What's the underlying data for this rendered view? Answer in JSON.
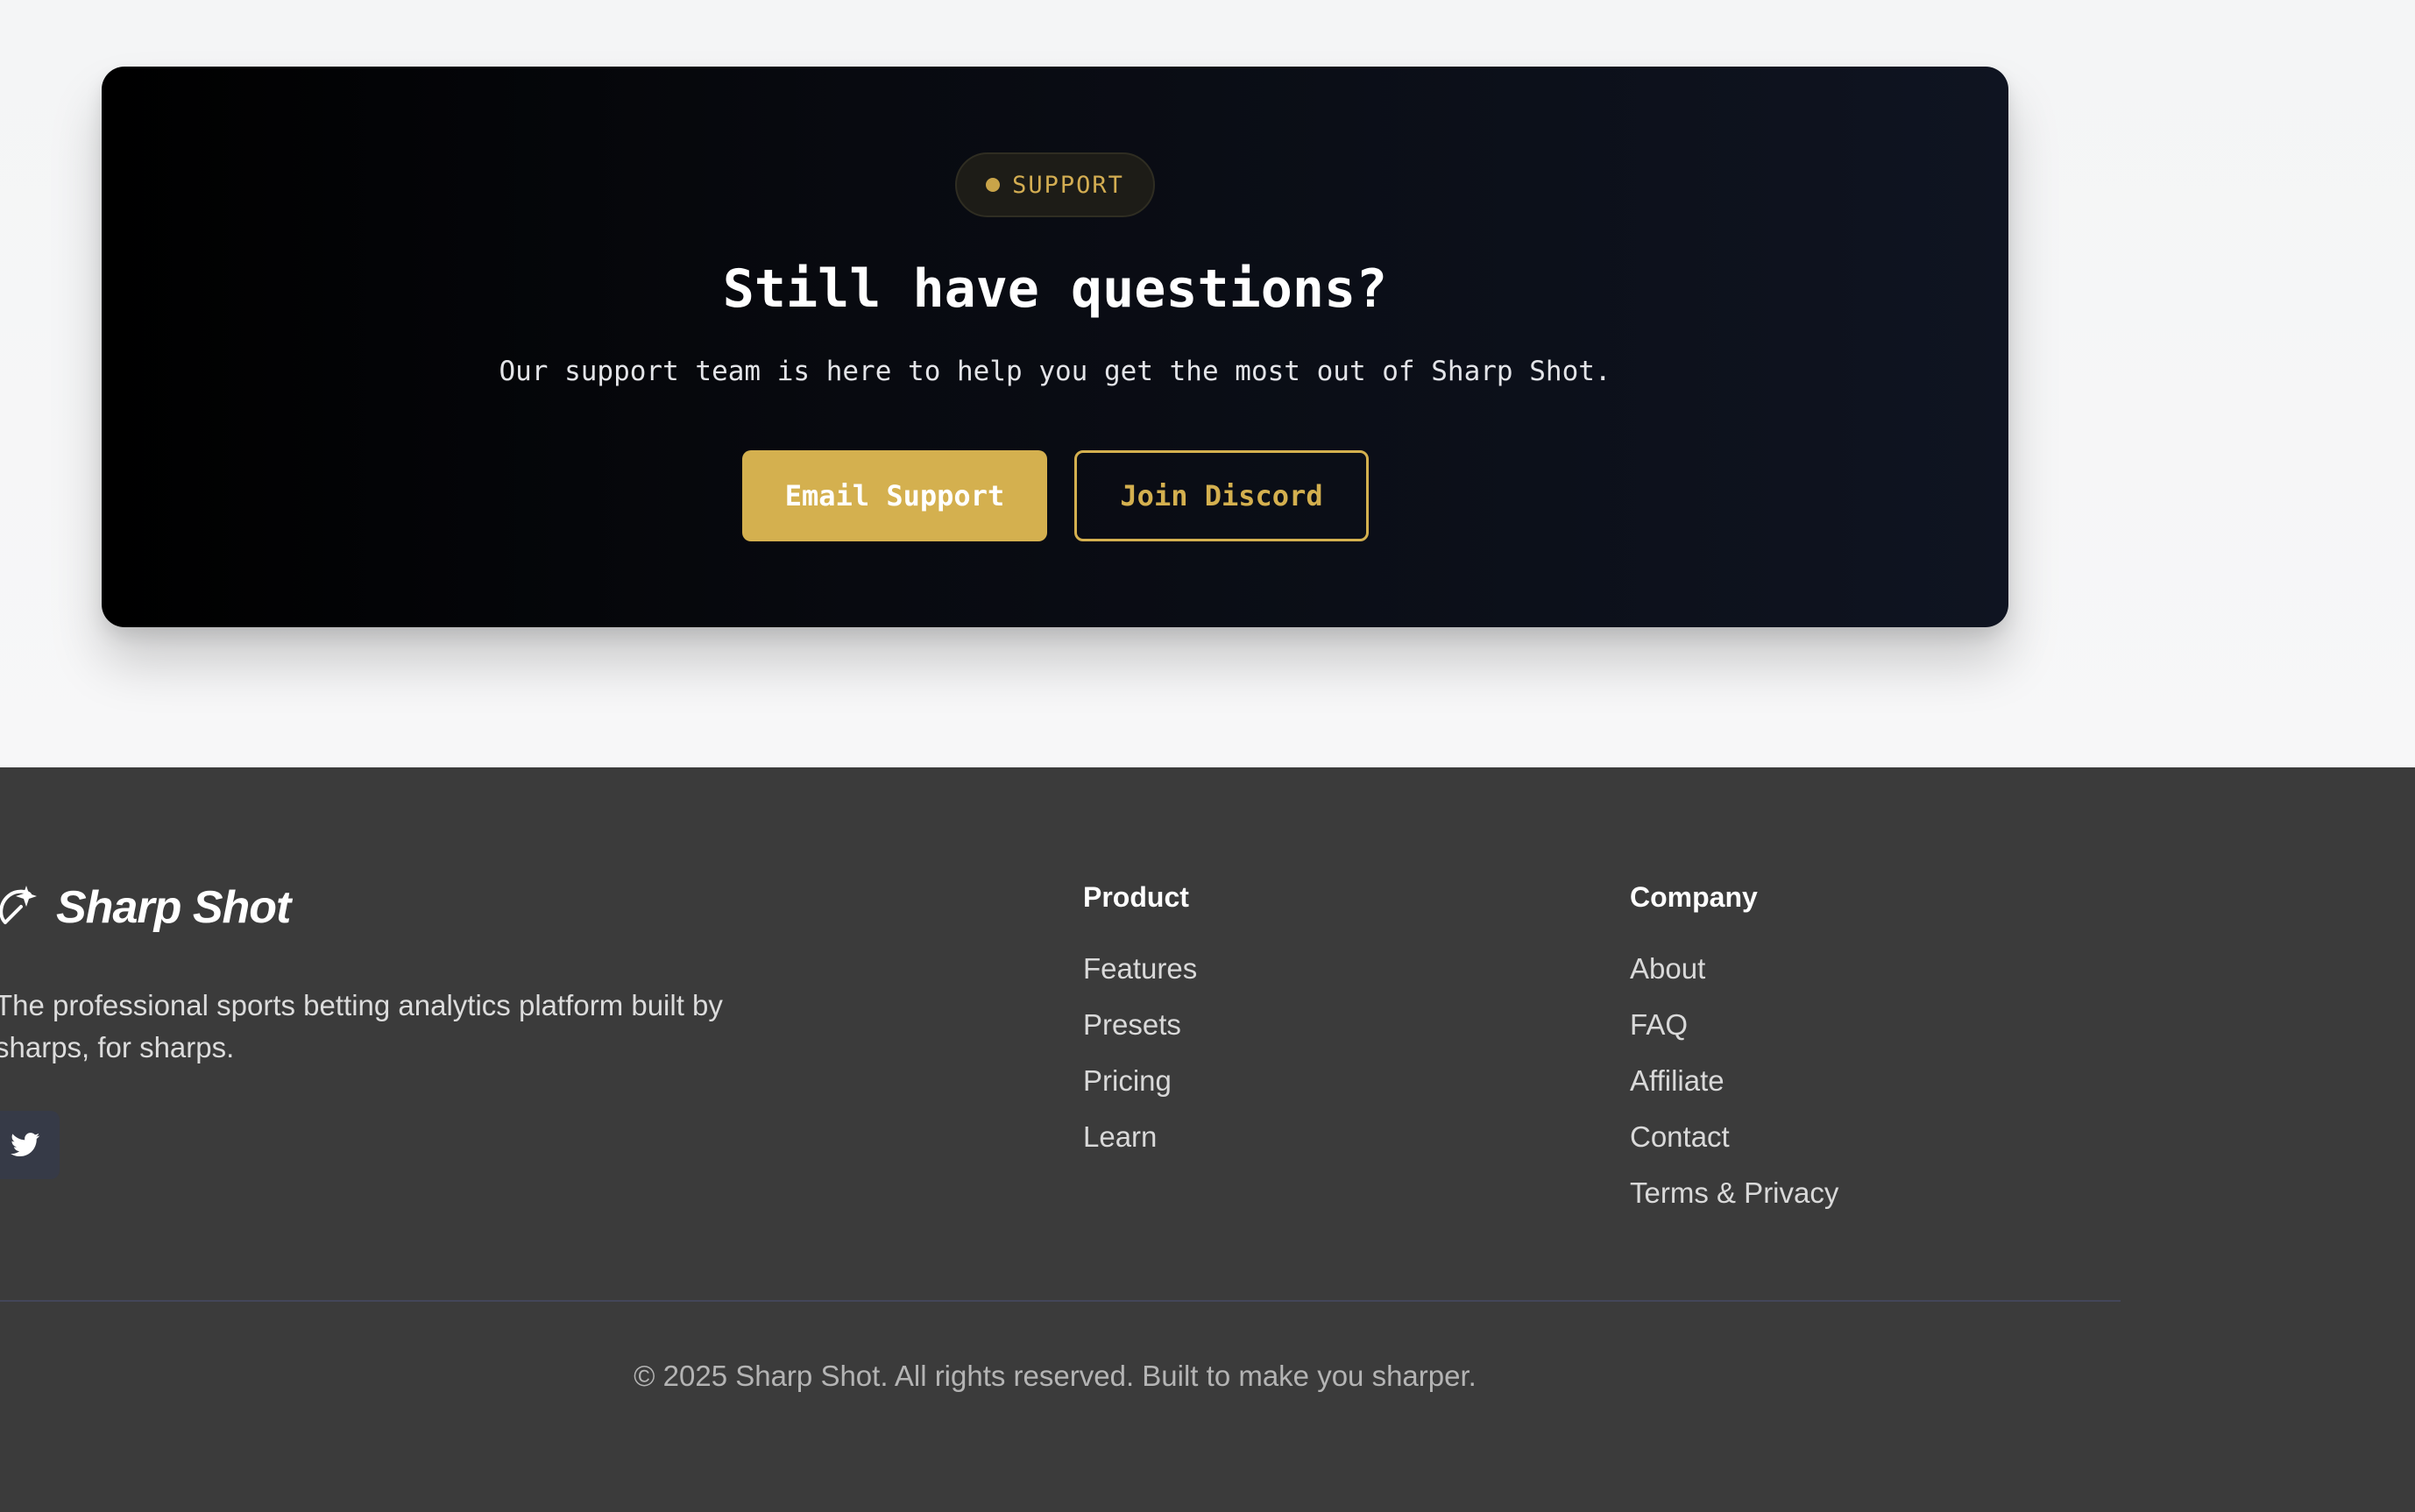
{
  "support": {
    "badge": "SUPPORT",
    "title": "Still have questions?",
    "subtitle": "Our support team is here to help you get the most out of Sharp Shot.",
    "email_button": "Email Support",
    "discord_button": "Join Discord"
  },
  "footer": {
    "brand_name": "Sharp Shot",
    "tagline": "The professional sports betting analytics platform built by sharps, for sharps.",
    "social": [
      {
        "icon": "twitter-icon"
      }
    ],
    "product": {
      "heading": "Product",
      "links": [
        "Features",
        "Presets",
        "Pricing",
        "Learn"
      ]
    },
    "company": {
      "heading": "Company",
      "links": [
        "About",
        "FAQ",
        "Affiliate",
        "Contact",
        "Terms & Privacy"
      ]
    },
    "copyright": "© 2025 Sharp Shot. All rights reserved. Built to make you sharper."
  },
  "colors": {
    "accent_gold": "#d4b04f",
    "card_dark": "#0f1421",
    "footer_bg": "#3b3b3b"
  }
}
